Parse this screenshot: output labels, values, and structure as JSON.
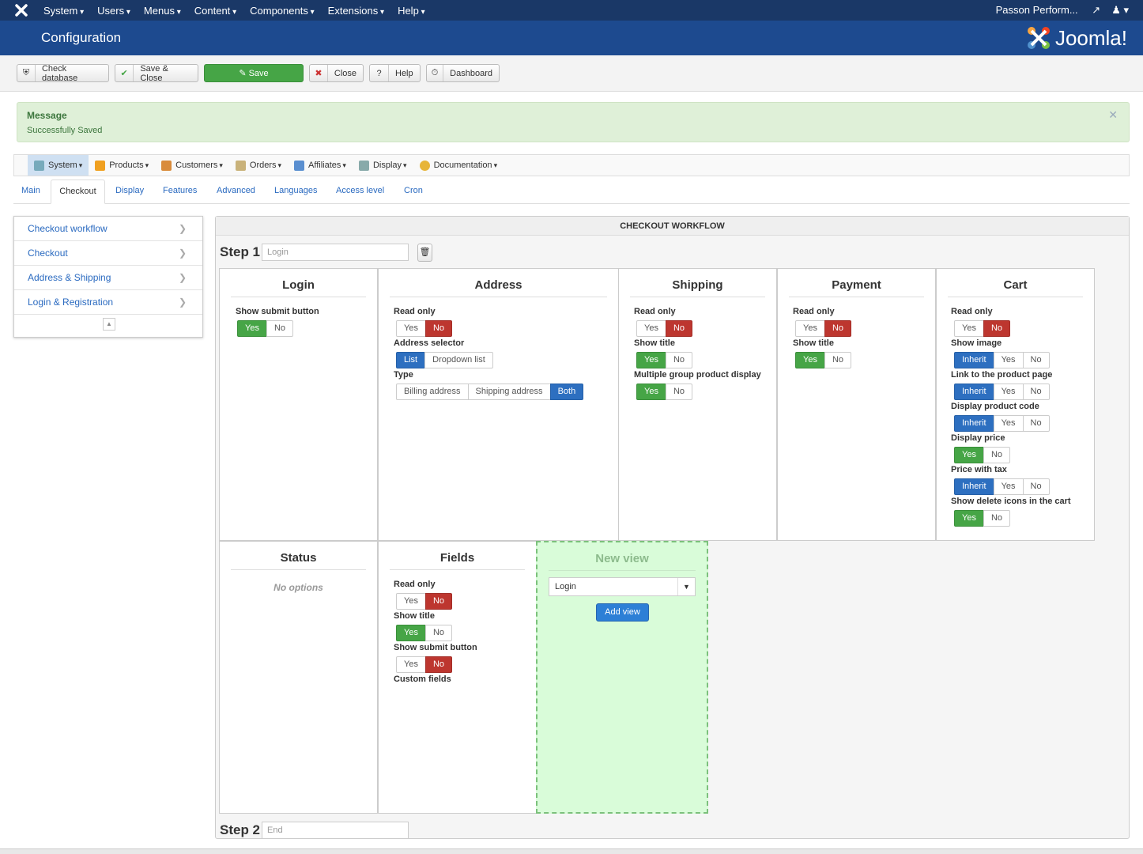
{
  "topnav": {
    "menus": [
      "System",
      "Users",
      "Menus",
      "Content",
      "Components",
      "Extensions",
      "Help"
    ],
    "site": "Passon Perform...",
    "user_icon": "user-icon"
  },
  "header": {
    "title": "Configuration",
    "brand": "Joomla!"
  },
  "toolbar": {
    "check_database": "Check database",
    "save_close": "Save & Close",
    "save": "Save",
    "close": "Close",
    "help": "Help",
    "dashboard": "Dashboard"
  },
  "message": {
    "heading": "Message",
    "text": "Successfully Saved"
  },
  "subnav": [
    "System",
    "Products",
    "Customers",
    "Orders",
    "Affiliates",
    "Display",
    "Documentation"
  ],
  "tabs": [
    "Main",
    "Checkout",
    "Display",
    "Features",
    "Advanced",
    "Languages",
    "Access level",
    "Cron"
  ],
  "sidebar": [
    "Checkout workflow",
    "Checkout",
    "Address & Shipping",
    "Login & Registration"
  ],
  "workflow": {
    "heading": "CHECKOUT WORKFLOW",
    "step1": {
      "label": "Step 1",
      "placeholder": "Login"
    },
    "step2": {
      "label": "Step 2",
      "placeholder": "End"
    },
    "login": {
      "title": "Login",
      "show_submit": "Show submit button",
      "yes": "Yes",
      "no": "No"
    },
    "address": {
      "title": "Address",
      "read_only": "Read only",
      "selector": "Address selector",
      "list": "List",
      "dropdown": "Dropdown list",
      "type": "Type",
      "billing": "Billing address",
      "shipping": "Shipping address",
      "both": "Both",
      "yes": "Yes",
      "no": "No"
    },
    "shipping": {
      "title": "Shipping",
      "read_only": "Read only",
      "show_title": "Show title",
      "multi": "Multiple group product display",
      "yes": "Yes",
      "no": "No"
    },
    "payment": {
      "title": "Payment",
      "read_only": "Read only",
      "show_title": "Show title",
      "yes": "Yes",
      "no": "No"
    },
    "cart": {
      "title": "Cart",
      "read_only": "Read only",
      "show_image": "Show image",
      "link_product": "Link to the product page",
      "product_code": "Display product code",
      "display_price": "Display price",
      "price_tax": "Price with tax",
      "delete_icons": "Show delete icons in the cart",
      "inherit": "Inherit",
      "yes": "Yes",
      "no": "No"
    },
    "status": {
      "title": "Status",
      "no_options": "No options"
    },
    "fields": {
      "title": "Fields",
      "read_only": "Read only",
      "show_title": "Show title",
      "show_submit": "Show submit button",
      "custom_fields": "Custom fields",
      "yes": "Yes",
      "no": "No"
    },
    "newview": {
      "title": "New view",
      "selected": "Login",
      "add": "Add view"
    }
  }
}
